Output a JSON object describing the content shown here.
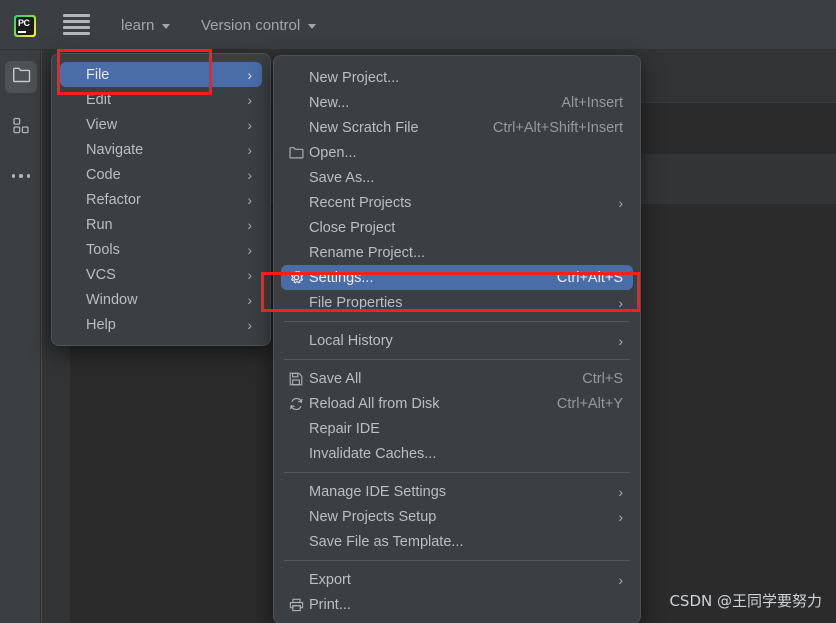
{
  "window": {
    "app": "PyCharm",
    "logo_text": "PC"
  },
  "toolbar": {
    "menu_icon": "hamburger-icon",
    "project_name": "learn",
    "vcs_widget": "Version control"
  },
  "toolstrip": {
    "items": [
      {
        "label": "Project",
        "icon": "folder-icon",
        "active": true
      },
      {
        "label": "Structure",
        "icon": "structure-icon",
        "active": false
      },
      {
        "label": "More tool windows",
        "icon": "ellipsis-icon",
        "active": false
      }
    ]
  },
  "main_menu": {
    "items": [
      {
        "label": "File",
        "submenu": true,
        "selected": true
      },
      {
        "label": "Edit",
        "submenu": true,
        "selected": false
      },
      {
        "label": "View",
        "submenu": true,
        "selected": false
      },
      {
        "label": "Navigate",
        "submenu": true,
        "selected": false
      },
      {
        "label": "Code",
        "submenu": true,
        "selected": false
      },
      {
        "label": "Refactor",
        "submenu": true,
        "selected": false
      },
      {
        "label": "Run",
        "submenu": true,
        "selected": false
      },
      {
        "label": "Tools",
        "submenu": true,
        "selected": false
      },
      {
        "label": "VCS",
        "submenu": true,
        "selected": false
      },
      {
        "label": "Window",
        "submenu": true,
        "selected": false
      },
      {
        "label": "Help",
        "submenu": true,
        "selected": false
      }
    ]
  },
  "file_menu": {
    "groups": [
      {
        "items": [
          {
            "label": "New Project...",
            "shortcut": "",
            "icon": "",
            "submenu": false,
            "selected": false
          },
          {
            "label": "New...",
            "shortcut": "Alt+Insert",
            "icon": "",
            "submenu": false,
            "selected": false
          },
          {
            "label": "New Scratch File",
            "shortcut": "Ctrl+Alt+Shift+Insert",
            "icon": "",
            "submenu": false,
            "selected": false
          },
          {
            "label": "Open...",
            "shortcut": "",
            "icon": "folder-icon",
            "submenu": false,
            "selected": false
          },
          {
            "label": "Save As...",
            "shortcut": "",
            "icon": "",
            "submenu": false,
            "selected": false
          },
          {
            "label": "Recent Projects",
            "shortcut": "",
            "icon": "",
            "submenu": true,
            "selected": false
          },
          {
            "label": "Close Project",
            "shortcut": "",
            "icon": "",
            "submenu": false,
            "selected": false
          },
          {
            "label": "Rename Project...",
            "shortcut": "",
            "icon": "",
            "submenu": false,
            "selected": false
          },
          {
            "label": "Settings...",
            "shortcut": "Ctrl+Alt+S",
            "icon": "gear-icon",
            "submenu": false,
            "selected": true
          },
          {
            "label": "File Properties",
            "shortcut": "",
            "icon": "",
            "submenu": true,
            "selected": false
          }
        ]
      },
      {
        "items": [
          {
            "label": "Local History",
            "shortcut": "",
            "icon": "",
            "submenu": true,
            "selected": false
          }
        ]
      },
      {
        "items": [
          {
            "label": "Save All",
            "shortcut": "Ctrl+S",
            "icon": "save-icon",
            "submenu": false,
            "selected": false
          },
          {
            "label": "Reload All from Disk",
            "shortcut": "Ctrl+Alt+Y",
            "icon": "refresh-icon",
            "submenu": false,
            "selected": false
          },
          {
            "label": "Repair IDE",
            "shortcut": "",
            "icon": "",
            "submenu": false,
            "selected": false
          },
          {
            "label": "Invalidate Caches...",
            "shortcut": "",
            "icon": "",
            "submenu": false,
            "selected": false
          }
        ]
      },
      {
        "items": [
          {
            "label": "Manage IDE Settings",
            "shortcut": "",
            "icon": "",
            "submenu": true,
            "selected": false
          },
          {
            "label": "New Projects Setup",
            "shortcut": "",
            "icon": "",
            "submenu": true,
            "selected": false
          },
          {
            "label": "Save File as Template...",
            "shortcut": "",
            "icon": "",
            "submenu": false,
            "selected": false
          }
        ]
      },
      {
        "items": [
          {
            "label": "Export",
            "shortcut": "",
            "icon": "",
            "submenu": true,
            "selected": false
          },
          {
            "label": "Print...",
            "shortcut": "",
            "icon": "print-icon",
            "submenu": false,
            "selected": false
          }
        ]
      }
    ]
  },
  "annotations": {
    "boxes": [
      {
        "target": "File",
        "color": "#fe1d1d"
      },
      {
        "target": "Settings...",
        "color": "#fe1d1d"
      }
    ]
  },
  "watermark": {
    "text": "CSDN @王同学要努力"
  },
  "colors": {
    "toolbar_bg": "#3c3f41",
    "editor_bg": "#2b2b2b",
    "menu_bg": "#3c3f41",
    "selection_blue": "#4a6da7",
    "annotation_red": "#fe1d1d",
    "text_primary": "#b9bec4"
  }
}
